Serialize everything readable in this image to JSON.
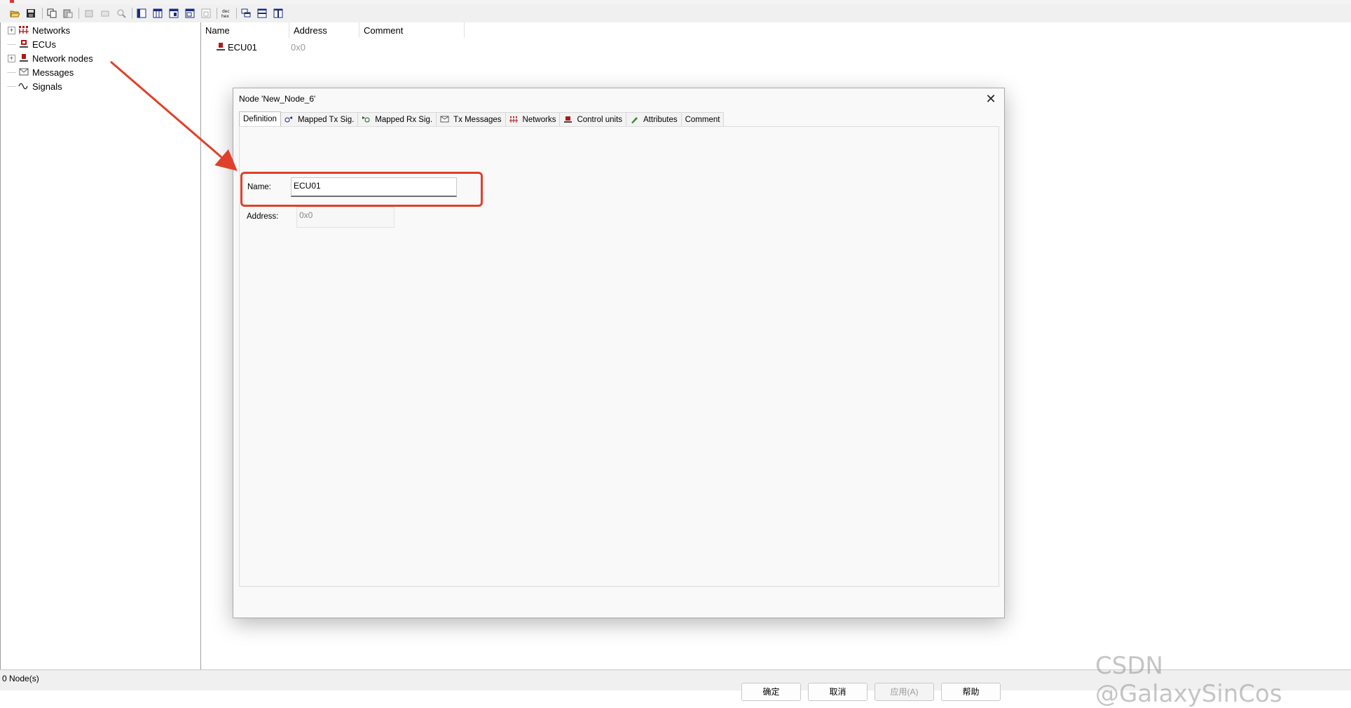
{
  "tree": {
    "items": [
      {
        "label": "Networks",
        "expandable": true,
        "icon": "networks-icon"
      },
      {
        "label": "ECUs",
        "expandable": false,
        "icon": "ecu-icon"
      },
      {
        "label": "Network nodes",
        "expandable": true,
        "icon": "network-node-icon"
      },
      {
        "label": "Messages",
        "expandable": false,
        "icon": "message-envelope-icon"
      },
      {
        "label": "Signals",
        "expandable": false,
        "icon": "signal-wave-icon"
      }
    ]
  },
  "list": {
    "columns": [
      "Name",
      "Address",
      "Comment"
    ],
    "rows": [
      {
        "name": "ECU01",
        "address": "0x0",
        "comment": ""
      }
    ]
  },
  "status": {
    "text": "0 Node(s)"
  },
  "dialog": {
    "title": "Node 'New_Node_6'",
    "tabs": [
      {
        "label": "Definition"
      },
      {
        "label": "Mapped Tx Sig."
      },
      {
        "label": "Mapped Rx Sig."
      },
      {
        "label": "Tx Messages"
      },
      {
        "label": "Networks"
      },
      {
        "label": "Control units"
      },
      {
        "label": "Attributes"
      },
      {
        "label": "Comment"
      }
    ],
    "fields": {
      "name_label": "Name:",
      "name_value": "ECU01",
      "address_label": "Address:",
      "address_value": "0x0"
    },
    "buttons": {
      "ok": "确定",
      "cancel": "取消",
      "apply": "应用(A)",
      "help": "帮助"
    }
  },
  "watermark": "CSDN @GalaxySinCos",
  "colors": {
    "highlight": "#e0402a",
    "accent_red": "#b01818"
  }
}
